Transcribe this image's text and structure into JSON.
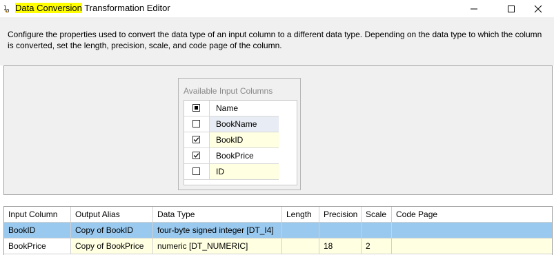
{
  "window": {
    "title_highlight": "Data Conversion",
    "title_rest": " Transformation Editor"
  },
  "description": "Configure the properties used to convert the data type of an input column to a different data type. Depending on the data type to which the column is converted, set the length, precision, scale, and code page of the column.",
  "available_columns": {
    "title": "Available Input Columns",
    "header": "Name",
    "items": [
      {
        "name": "BookName",
        "checked": false
      },
      {
        "name": "BookID",
        "checked": true
      },
      {
        "name": "BookPrice",
        "checked": true
      },
      {
        "name": "ID",
        "checked": false
      }
    ]
  },
  "grid": {
    "headers": [
      "Input Column",
      "Output Alias",
      "Data Type",
      "Length",
      "Precision",
      "Scale",
      "Code Page"
    ],
    "rows": [
      {
        "input": "BookID",
        "alias": "Copy of BookID",
        "type": "four-byte signed integer [DT_I4]",
        "length": "",
        "precision": "",
        "scale": "",
        "codepage": ""
      },
      {
        "input": "BookPrice",
        "alias": "Copy of BookPrice",
        "type": "numeric [DT_NUMERIC]",
        "length": "",
        "precision": "18",
        "scale": "2",
        "codepage": ""
      }
    ]
  },
  "colors": {
    "selected_row": "#99c9ef",
    "edit_row": "#ffffe1",
    "title_highlight": "#ffff00"
  }
}
